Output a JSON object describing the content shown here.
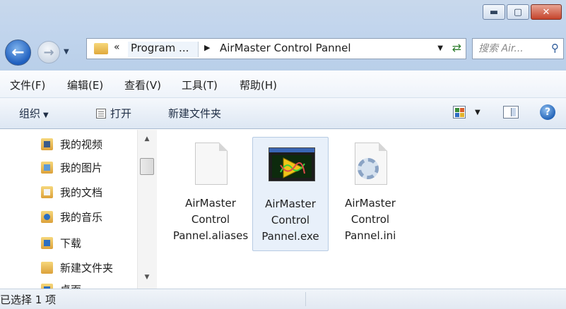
{
  "address": {
    "collapse_marker": "«",
    "segments": [
      "Program ...",
      "AirMaster Control Pannel"
    ]
  },
  "search": {
    "placeholder": "搜索 Air..."
  },
  "menu": [
    "文件(F)",
    "编辑(E)",
    "查看(V)",
    "工具(T)",
    "帮助(H)"
  ],
  "toolbar": {
    "organize": "组织",
    "open": "打开",
    "new_folder": "新建文件夹"
  },
  "nav": {
    "items": [
      {
        "label": "我的视频",
        "icon": "videos-folder-icon"
      },
      {
        "label": "我的图片",
        "icon": "pictures-folder-icon"
      },
      {
        "label": "我的文档",
        "icon": "documents-folder-icon"
      },
      {
        "label": "我的音乐",
        "icon": "music-folder-icon"
      },
      {
        "label": "下载",
        "icon": "downloads-folder-icon"
      },
      {
        "label": "新建文件夹",
        "icon": "folder-icon"
      },
      {
        "label": "桌面",
        "icon": "desktop-folder-icon"
      }
    ]
  },
  "files": [
    {
      "name": "AirMaster Control Pannel.aliases",
      "icon": "document-file-icon",
      "selected": false
    },
    {
      "name": "AirMaster Control Pannel.exe",
      "icon": "labview-exe-icon",
      "selected": true
    },
    {
      "name": "AirMaster Control Pannel.ini",
      "icon": "settings-file-icon",
      "selected": false
    }
  ],
  "status": {
    "text": "已选择 1 项"
  },
  "colors": {
    "selection_bg": "#e8f0fa",
    "chrome_blue": "#c2d5ed",
    "close_red": "#c5432b"
  }
}
